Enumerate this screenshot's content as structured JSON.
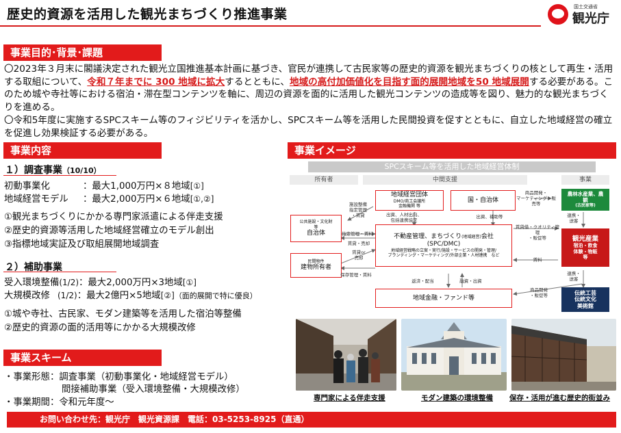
{
  "header": {
    "title": "歴史的資源を活用した観光まちづくり推進事業",
    "logo_sub": "国土交通省",
    "logo_main": "観光庁"
  },
  "purpose": {
    "heading": "事業目的･背景･課題",
    "p1_a": "〇2023年３月末に閣議決定された観光立国推進基本計画に基づき、官民が連携して古民家等の歴史的資源を観光まちづくりの核として再生・活用する取組について、",
    "p1_red1": "令和７年までに 300 地域に拡大",
    "p1_b": "するとともに、",
    "p1_red2": "地域の高付加価値化を目指す面的展開地域を50 地域展開",
    "p1_c": "する必要がある。このため城や寺社等における宿泊・滞在型コンテンツを軸に、周辺の資源を面的に活用した観光コンテンツの造成等を図り、魅力的な観光まちづくりを進める。",
    "p2": "〇令和5年度に実施するSPCスキーム等のフィジビリティを活かし、SPCスキーム等を活用した民間投資を促すとともに、自立した地域経営の確立を促進し効果検証する必要がある。"
  },
  "content": {
    "heading": "事業内容",
    "survey": {
      "title": "１）調査事業",
      "ratio": "（10/10）",
      "row1_label": "初動事業化",
      "row1_colon": "：",
      "row1_value": "最大1,000万円×８地域",
      "row1_ref": "[①]",
      "row2_label": "地域経営モデル",
      "row2_colon": "：",
      "row2_value": "最大2,000万円×６地域",
      "row2_ref": "[①,②]",
      "items": [
        "①観光まちづくりにかかる専門家派遣による伴走支援",
        "②歴史的資源等活用した地域経営確立のモデル創出",
        "③指標地域実証及び取組展開地域調査"
      ]
    },
    "subsidy": {
      "title": "２）補助事業",
      "row1_label": "受入環境整備",
      "row1_ratio": "(1/2)",
      "row1_value": "：最大2,000万円×3地域",
      "row1_ref": "[①]",
      "row2_label": "大規模改修",
      "row2_ratio": "(1/2)",
      "row2_value": "：最大2億円×5地域",
      "row2_ref": "[②]",
      "row2_note": "（面的展開で特に優良）",
      "items": [
        "①城や寺社、古民家、モダン建築等を活用した宿泊等整備",
        "②歴史的資源の面的活用等にかかる大規模改修"
      ]
    }
  },
  "scheme": {
    "heading": "事業スキーム",
    "form_label": "・事業形態：",
    "form_1": "調査事業（初動事業化・地域経営モデル）",
    "form_2": "間接補助事業（受入環境整備・大規模改修）",
    "period_label": "・事業期間：",
    "period_value": "令和元年度～"
  },
  "image": {
    "heading": "事業イメージ",
    "banner": "SPCスキーム等を活用した地域経営体制",
    "col_owner": "所有者",
    "col_support": "中間支援",
    "col_business": "事業",
    "box_public_1": "公共施設・文化財",
    "box_public_2": "等",
    "box_public_3": "自治体",
    "box_private_1": "民間物件",
    "box_private_2": "建物所有者",
    "box_org_1": "地域経営団体",
    "box_org_2": "DMO/商工会議所",
    "box_org_3": "金融機関 等",
    "box_gov": "国・自治体",
    "box_spc_1": "不動産管理、まちづくり",
    "box_spc_1_small": "(地域経営)",
    "box_spc_1_tail": "会社",
    "box_spc_2": "(SPC/DMC)",
    "box_spc_3": "地域経営戦略の立案・実行/施設・サービスの開発・管理/",
    "box_spc_4": "ブランディング・マーケティング/外部企業・人材連携　など",
    "box_fund": "地域金融・ファンド等",
    "box_green_1": "農林水産業、農",
    "box_green_2": "観",
    "box_green_3": "(古民家等)",
    "box_red_1": "観光産業",
    "box_red_2": "宿泊・飲食",
    "box_red_3": "体験・物販",
    "box_red_4": "等",
    "box_navy_1": "伝統工芸",
    "box_navy_2": "伝統文化",
    "box_navy_3": "美術館",
    "lbl_1": "施設整備\n指定管理\n・賃貸",
    "lbl_2": "指定管理・賃料",
    "lbl_3": "賃貸・売却",
    "lbl_4": "賃貸or\n売却",
    "lbl_5": "保存管理・賃料",
    "lbl_6": "出資、人材出向、\n包括連携協定",
    "lbl_7": "出資、補助等",
    "lbl_8": "商品開発・\nマーケティング・販\n売等",
    "lbl_9": "賃貸借・クオリティ管理\n・販促等",
    "lbl_10": "賃料",
    "lbl_11": "商品開発\n・販促等",
    "lbl_12": "返済・配当",
    "lbl_13": "融資・出資",
    "lbl_14": "連携・\n送客",
    "lbl_15": "連携・\n送客"
  },
  "photos": [
    {
      "caption": "専門家による伴走支援"
    },
    {
      "caption": "モダン建築の環境整備"
    },
    {
      "caption": "保存・活用が進む歴史的街並み"
    }
  ],
  "contact": "お問い合わせ先：観光庁　観光資源課　電話：03-5253-8925（直通）",
  "colors": {
    "accent": "#e21b1b",
    "green": "#1d8a3c",
    "navy": "#17325e"
  }
}
